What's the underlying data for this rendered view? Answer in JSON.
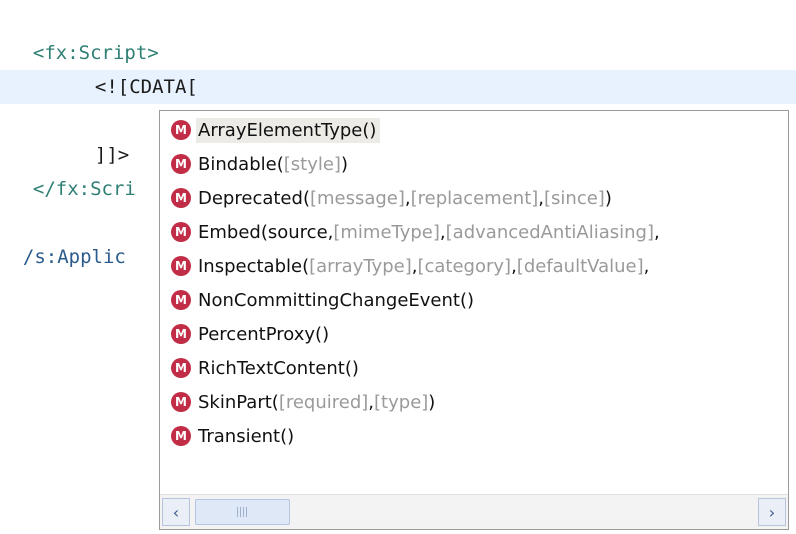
{
  "editor": {
    "lines": {
      "script_open": "<fx:Script>",
      "cdata_open": "<![CDATA[",
      "bracket": "[",
      "cdata_close": "]]>",
      "script_close_partial": "</fx:Scri",
      "application_close_partial": "/s:Applic"
    }
  },
  "autocomplete": {
    "icon_letter": "M",
    "items": [
      {
        "name": "ArrayElementType",
        "parts": [
          {
            "t": "()",
            "opt": false
          }
        ]
      },
      {
        "name": "Bindable",
        "parts": [
          {
            "t": "(",
            "opt": false
          },
          {
            "t": "[style]",
            "opt": true
          },
          {
            "t": ")",
            "opt": false
          }
        ]
      },
      {
        "name": "Deprecated",
        "parts": [
          {
            "t": "(",
            "opt": false
          },
          {
            "t": "[message]",
            "opt": true
          },
          {
            "t": ",",
            "opt": false
          },
          {
            "t": "[replacement]",
            "opt": true
          },
          {
            "t": ",",
            "opt": false
          },
          {
            "t": "[since]",
            "opt": true
          },
          {
            "t": ")",
            "opt": false
          }
        ]
      },
      {
        "name": "Embed",
        "parts": [
          {
            "t": "(source,",
            "opt": false
          },
          {
            "t": "[mimeType]",
            "opt": true
          },
          {
            "t": ",",
            "opt": false
          },
          {
            "t": "[advancedAntiAliasing]",
            "opt": true
          },
          {
            "t": ",",
            "opt": false
          }
        ]
      },
      {
        "name": "Inspectable",
        "parts": [
          {
            "t": "(",
            "opt": false
          },
          {
            "t": "[arrayType]",
            "opt": true
          },
          {
            "t": ",",
            "opt": false
          },
          {
            "t": "[category]",
            "opt": true
          },
          {
            "t": ",",
            "opt": false
          },
          {
            "t": "[defaultValue]",
            "opt": true
          },
          {
            "t": ",",
            "opt": false
          }
        ]
      },
      {
        "name": "NonCommittingChangeEvent",
        "parts": [
          {
            "t": "()",
            "opt": false
          }
        ]
      },
      {
        "name": "PercentProxy",
        "parts": [
          {
            "t": "()",
            "opt": false
          }
        ]
      },
      {
        "name": "RichTextContent",
        "parts": [
          {
            "t": "()",
            "opt": false
          }
        ]
      },
      {
        "name": "SkinPart",
        "parts": [
          {
            "t": "(",
            "opt": false
          },
          {
            "t": "[required]",
            "opt": true
          },
          {
            "t": ",",
            "opt": false
          },
          {
            "t": "[type]",
            "opt": true
          },
          {
            "t": ")",
            "opt": false
          }
        ]
      },
      {
        "name": "Transient",
        "parts": [
          {
            "t": "()",
            "opt": false
          }
        ]
      }
    ],
    "selected_index": 0,
    "scrollbar": {
      "left_arrow_icon": "chevron-left-icon",
      "right_arrow_icon": "chevron-right-icon",
      "left_glyph": "‹",
      "right_glyph": "›"
    }
  }
}
